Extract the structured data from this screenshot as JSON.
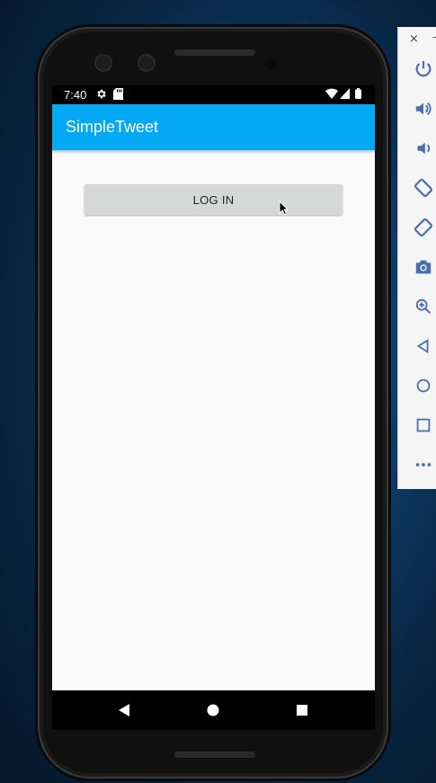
{
  "status_bar": {
    "time": "7:40"
  },
  "app_bar": {
    "title": "SimpleTweet"
  },
  "main": {
    "login_label": "LOG IN"
  },
  "colors": {
    "app_bar": "#03a9f4",
    "screen_bg": "#fafafa",
    "button_bg": "#d6d7d7"
  },
  "nav_bar": {
    "icons": [
      "back-icon",
      "home-icon",
      "recents-icon"
    ]
  },
  "emulator_panel": {
    "window_controls": [
      "×",
      "–"
    ],
    "tools": [
      "power-icon",
      "volume-up-icon",
      "volume-down-icon",
      "rotate-left-icon",
      "rotate-right-icon",
      "camera-icon",
      "zoom-icon",
      "back-icon",
      "home-icon",
      "overview-icon",
      "more-icon"
    ]
  }
}
